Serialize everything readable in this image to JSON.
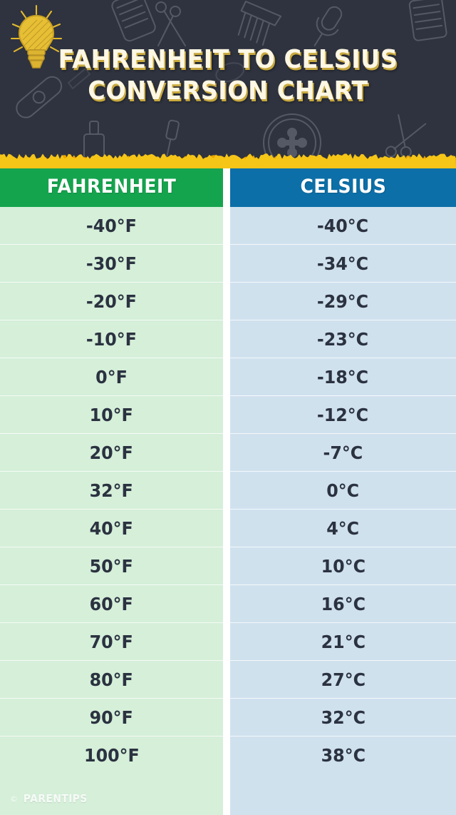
{
  "header": {
    "title_line1": "FAHRENHEIT TO CELSIUS",
    "title_line2": "CONVERSION CHART",
    "bulb_icon": "lightbulb-icon",
    "background_doodles": [
      "scissors-icon",
      "clipper-icon",
      "comb-icon",
      "microphone-icon",
      "razor-icon",
      "nail-polish-icon",
      "shower-head-icon",
      "hair-dryer-icon",
      "bandage-icon"
    ],
    "background_color": "#2f333f",
    "title_color": "#fdf7e4",
    "title_shadow_color": "#c8a93f"
  },
  "torn_edge": {
    "color": "#f5c518",
    "accent_color": "#f0a500"
  },
  "table": {
    "columns": [
      {
        "key": "fahrenheit",
        "label": "FAHRENHEIT",
        "header_bg": "#15a44e",
        "cell_bg": "#d5efd9"
      },
      {
        "key": "celsius",
        "label": "CELSIUS",
        "header_bg": "#0c6fa8",
        "cell_bg": "#d0e1ee"
      }
    ],
    "cell_text_color": "#2b3240",
    "rows": [
      {
        "fahrenheit": "-40°F",
        "celsius": "-40°C"
      },
      {
        "fahrenheit": "-30°F",
        "celsius": "-34°C"
      },
      {
        "fahrenheit": "-20°F",
        "celsius": "-29°C"
      },
      {
        "fahrenheit": "-10°F",
        "celsius": "-23°C"
      },
      {
        "fahrenheit": "0°F",
        "celsius": "-18°C"
      },
      {
        "fahrenheit": "10°F",
        "celsius": "-12°C"
      },
      {
        "fahrenheit": "20°F",
        "celsius": "-7°C"
      },
      {
        "fahrenheit": "32°F",
        "celsius": "0°C"
      },
      {
        "fahrenheit": "40°F",
        "celsius": "4°C"
      },
      {
        "fahrenheit": "50°F",
        "celsius": "10°C"
      },
      {
        "fahrenheit": "60°F",
        "celsius": "16°C"
      },
      {
        "fahrenheit": "70°F",
        "celsius": "21°C"
      },
      {
        "fahrenheit": "80°F",
        "celsius": "27°C"
      },
      {
        "fahrenheit": "90°F",
        "celsius": "32°C"
      },
      {
        "fahrenheit": "100°F",
        "celsius": "38°C"
      }
    ]
  },
  "watermark": {
    "copyright_symbol": "©",
    "text": "PARENTIPS"
  },
  "chart_data": {
    "type": "table",
    "title": "FAHRENHEIT TO CELSIUS CONVERSION CHART",
    "columns": [
      "FAHRENHEIT",
      "CELSIUS"
    ],
    "xlabel": "Fahrenheit (°F)",
    "ylabel": "Celsius (°C)",
    "categories": [
      "-40°F",
      "-30°F",
      "-20°F",
      "-10°F",
      "0°F",
      "10°F",
      "20°F",
      "32°F",
      "40°F",
      "50°F",
      "60°F",
      "70°F",
      "80°F",
      "90°F",
      "100°F"
    ],
    "x": [
      -40,
      -30,
      -20,
      -10,
      0,
      10,
      20,
      32,
      40,
      50,
      60,
      70,
      80,
      90,
      100
    ],
    "values": [
      -40,
      -34,
      -29,
      -23,
      -18,
      -12,
      -7,
      0,
      4,
      10,
      16,
      21,
      27,
      32,
      38
    ],
    "rows": [
      [
        "-40°F",
        "-40°C"
      ],
      [
        "-30°F",
        "-34°C"
      ],
      [
        "-20°F",
        "-29°C"
      ],
      [
        "-10°F",
        "-23°C"
      ],
      [
        "0°F",
        "-18°C"
      ],
      [
        "10°F",
        "-12°C"
      ],
      [
        "20°F",
        "-7°C"
      ],
      [
        "32°F",
        "0°C"
      ],
      [
        "40°F",
        "4°C"
      ],
      [
        "50°F",
        "10°C"
      ],
      [
        "60°F",
        "16°C"
      ],
      [
        "70°F",
        "21°C"
      ],
      [
        "80°F",
        "27°C"
      ],
      [
        "90°F",
        "32°C"
      ],
      [
        "100°F",
        "38°C"
      ]
    ]
  }
}
